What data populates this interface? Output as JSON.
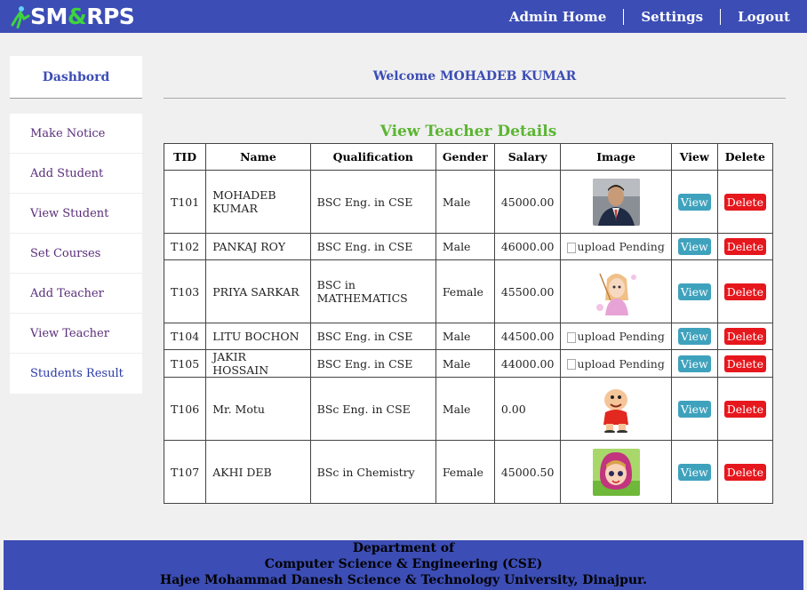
{
  "logo": {
    "part1": "SM",
    "amp": "&",
    "part2": "RPS"
  },
  "nav": {
    "home": "Admin Home",
    "settings": "Settings",
    "logout": "Logout"
  },
  "sidebar": {
    "title": "Dashbord",
    "items": [
      "Make Notice",
      "Add Student",
      "View Student",
      "Set Courses",
      "Add Teacher",
      "View Teacher",
      "Students Result"
    ]
  },
  "welcome": "Welcome MOHADEB KUMAR",
  "heading": "View Teacher Details",
  "table": {
    "headers": [
      "TID",
      "Name",
      "Qualification",
      "Gender",
      "Salary",
      "Image",
      "View",
      "Delete"
    ],
    "rows": [
      {
        "tid": "T101",
        "name": "MOHADEB KUMAR",
        "qual": "BSC Eng. in CSE",
        "gender": "Male",
        "salary": "45000.00",
        "image": "photo",
        "view": "View",
        "delete": "Delete"
      },
      {
        "tid": "T102",
        "name": "PANKAJ ROY",
        "qual": "BSC Eng. in CSE",
        "gender": "Male",
        "salary": "46000.00",
        "image": "upload Pending",
        "view": "View",
        "delete": "Delete"
      },
      {
        "tid": "T103",
        "name": "PRIYA SARKAR",
        "qual": "BSC in MATHEMATICS",
        "gender": "Female",
        "salary": "45500.00",
        "image": "photo",
        "view": "View",
        "delete": "Delete"
      },
      {
        "tid": "T104",
        "name": "LITU BOCHON",
        "qual": "BSC Eng. in CSE",
        "gender": "Male",
        "salary": "44500.00",
        "image": "upload Pending",
        "view": "View",
        "delete": "Delete"
      },
      {
        "tid": "T105",
        "name": "JAKIR HOSSAIN",
        "qual": "BSC Eng. in CSE",
        "gender": "Male",
        "salary": "44000.00",
        "image": "upload Pending",
        "view": "View",
        "delete": "Delete"
      },
      {
        "tid": "T106",
        "name": "Mr. Motu",
        "qual": "BSc Eng. in CSE",
        "gender": "Male",
        "salary": "0.00",
        "image": "photo",
        "view": "View",
        "delete": "Delete"
      },
      {
        "tid": "T107",
        "name": "AKHI DEB",
        "qual": "BSc in Chemistry",
        "gender": "Female",
        "salary": "45000.50",
        "image": "photo",
        "view": "View",
        "delete": "Delete"
      }
    ]
  },
  "footer": {
    "line1": "Department of",
    "line2": "Computer Science & Engineering (CSE)",
    "line3": "Hajee Mohammad Danesh Science & Technology University, Dinajpur."
  },
  "colors": {
    "brand": "#3c4db5",
    "heading": "#5bb532",
    "view": "#3fa2bd",
    "delete": "#e6171d"
  }
}
